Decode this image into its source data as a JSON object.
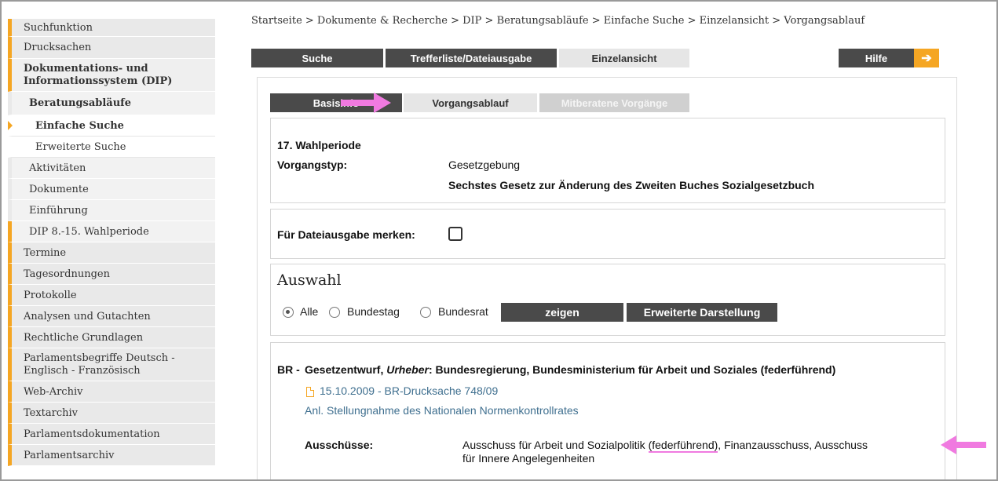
{
  "sidebar": {
    "items": [
      {
        "label": "Suchfunktion"
      },
      {
        "label": "Drucksachen"
      },
      {
        "label": "Dokumentations- und Informationssystem (DIP)"
      },
      {
        "label": "Beratungsabläufe"
      },
      {
        "label": "Einfache Suche"
      },
      {
        "label": "Erweiterte Suche"
      },
      {
        "label": "Aktivitäten"
      },
      {
        "label": "Dokumente"
      },
      {
        "label": "Einführung"
      },
      {
        "label": "DIP 8.-15. Wahlperiode"
      },
      {
        "label": "Termine"
      },
      {
        "label": "Tagesordnungen"
      },
      {
        "label": "Protokolle"
      },
      {
        "label": "Analysen und Gutachten"
      },
      {
        "label": "Rechtliche Grundlagen"
      },
      {
        "label": "Parlamentsbegriffe Deutsch - Englisch - Französisch"
      },
      {
        "label": "Web-Archiv"
      },
      {
        "label": "Textarchiv"
      },
      {
        "label": "Parlamentsdokumentation"
      },
      {
        "label": "Parlamentsarchiv"
      }
    ]
  },
  "breadcrumb": "Startseite > Dokumente & Recherche > DIP > Beratungsabläufe > Einfache Suche > Einzelansicht > Vorgangsablauf",
  "tabs": {
    "suche": "Suche",
    "trefferliste": "Trefferliste/Dateiausgabe",
    "einzelansicht": "Einzelansicht",
    "hilfe": "Hilfe"
  },
  "subtabs": {
    "basisinfo": "Basisinfo",
    "vorgangsablauf": "Vorgangsablauf",
    "mitberatene": "Mitberatene Vorgänge"
  },
  "info": {
    "wahlperiode": "17. Wahlperiode",
    "vorgangstyp_label": "Vorgangstyp:",
    "vorgangstyp_value": "Gesetzgebung",
    "title": "Sechstes Gesetz zur Änderung des Zweiten Buches Sozialgesetzbuch"
  },
  "merken": {
    "label": "Für Dateiausgabe merken:"
  },
  "auswahl": {
    "heading": "Auswahl",
    "options": [
      "Alle",
      "Bundestag",
      "Bundesrat"
    ],
    "selected": "Alle",
    "zeigen": "zeigen",
    "erweitert": "Erweiterte Darstellung"
  },
  "entry": {
    "prefix": "BR -",
    "text_a": "Gesetzentwurf,",
    "urheber": "Urheber",
    "text_b": ": Bundesregierung, Bundesministerium für Arbeit und Soziales (federführend)",
    "doc_link": "15.10.2009 - BR-Drucksache 748/09",
    "anl_link": "Anl. Stellungnahme des Nationalen Normenkontrollrates",
    "ausschuesse_label": "Ausschüsse:",
    "ausschuesse_line1_a": "Ausschuss für Arbeit und Sozialpolitik ",
    "ausschuesse_line1_b": "(federführend)",
    "ausschuesse_line1_c": ", Finanzausschuss, Ausschuss",
    "ausschuesse_line2": "für Innere Angelegenheiten"
  },
  "colors": {
    "accent": "#f5a623",
    "dark_tab": "#4a4a4a",
    "annotation": "#f07ae0",
    "link": "#3f6f8f"
  }
}
